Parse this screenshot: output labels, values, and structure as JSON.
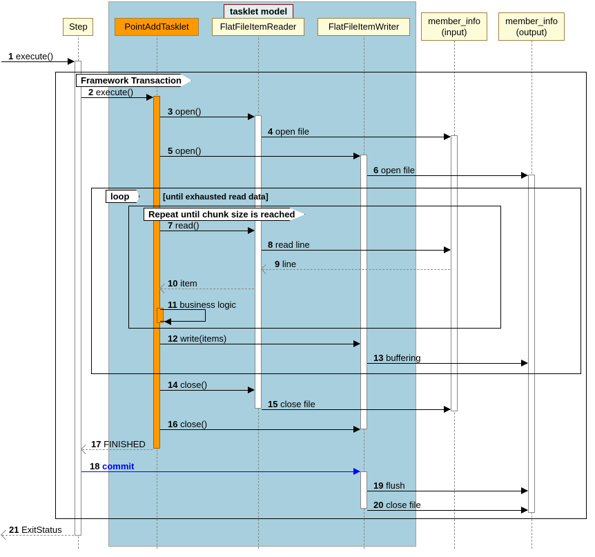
{
  "title": "tasklet model",
  "participants": {
    "step": "Step",
    "tasklet": "PointAddTasklet",
    "reader": "FlatFileItemReader",
    "writer": "FlatFileItemWriter",
    "input": "member_info\n(input)",
    "output": "member_info\n(output)"
  },
  "frames": {
    "transaction": "Framework Transaction",
    "loop": "loop",
    "loop_cond": "[until exhausted read data]",
    "repeat": "Repeat until chunk size is reached"
  },
  "messages": {
    "m1": {
      "n": "1",
      "t": "execute()"
    },
    "m2": {
      "n": "2",
      "t": "execute()"
    },
    "m3": {
      "n": "3",
      "t": "open()"
    },
    "m4": {
      "n": "4",
      "t": "open file"
    },
    "m5": {
      "n": "5",
      "t": "open()"
    },
    "m6": {
      "n": "6",
      "t": "open file"
    },
    "m7": {
      "n": "7",
      "t": "read()"
    },
    "m8": {
      "n": "8",
      "t": "read line"
    },
    "m9": {
      "n": "9",
      "t": "line"
    },
    "m10": {
      "n": "10",
      "t": "item"
    },
    "m11": {
      "n": "11",
      "t": "business logic"
    },
    "m12": {
      "n": "12",
      "t": "write(items)"
    },
    "m13": {
      "n": "13",
      "t": "buffering"
    },
    "m14": {
      "n": "14",
      "t": "close()"
    },
    "m15": {
      "n": "15",
      "t": "close file"
    },
    "m16": {
      "n": "16",
      "t": "close()"
    },
    "m17": {
      "n": "17",
      "t": "FINISHED"
    },
    "m18": {
      "n": "18",
      "t": "commit"
    },
    "m19": {
      "n": "19",
      "t": "flush"
    },
    "m20": {
      "n": "20",
      "t": "close file"
    },
    "m21": {
      "n": "21",
      "t": "ExitStatus"
    }
  }
}
